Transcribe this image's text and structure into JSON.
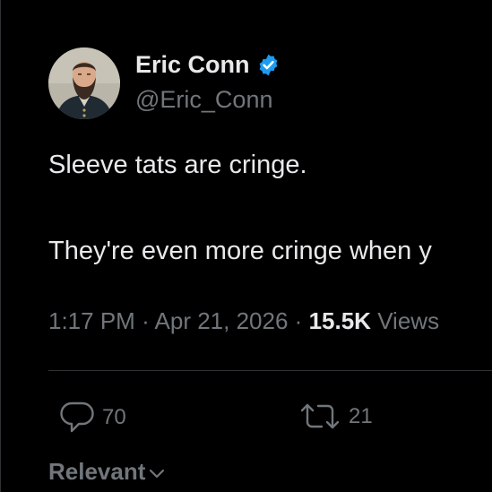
{
  "author": {
    "display_name": "Eric Conn",
    "handle": "@Eric_Conn",
    "verified_icon": "verified-badge-icon",
    "verified_color": "#1d9bf0"
  },
  "tweet": {
    "line1": "Sleeve tats are cringe.",
    "line2": "They're even more cringe when y"
  },
  "meta": {
    "time": "1:17 PM",
    "separator": "·",
    "date": "Apr 21, 2026",
    "views_count": "15.5K",
    "views_label": "Views"
  },
  "actions": {
    "reply": {
      "icon": "reply-icon",
      "count": "70"
    },
    "retweet": {
      "icon": "retweet-icon",
      "count": "21"
    }
  },
  "replies_sort": {
    "label": "Relevant",
    "icon": "chevron-down-icon"
  },
  "colors": {
    "background": "#000000",
    "primary_text": "#e7e9ea",
    "secondary_text": "#71767b",
    "divider": "#2f3336",
    "accent": "#1d9bf0"
  }
}
